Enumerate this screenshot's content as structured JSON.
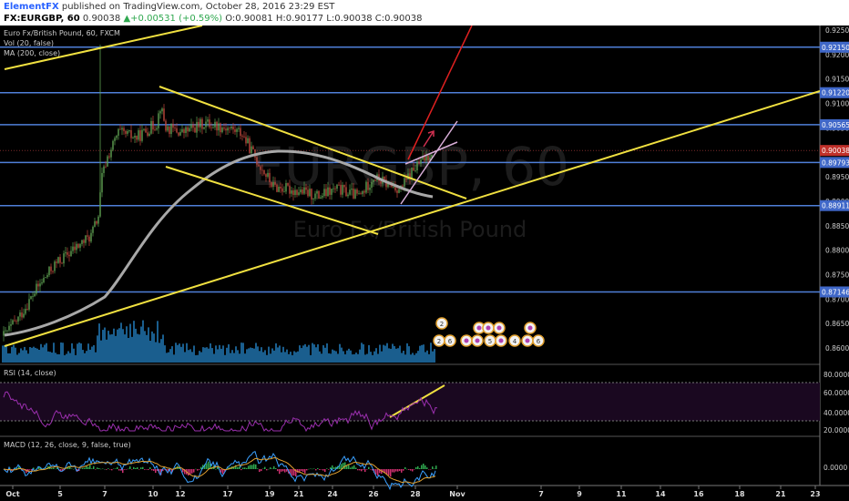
{
  "header": {
    "author": "ElementFX",
    "published": "published on TradingView.com, October 28, 2016 23:29 EST",
    "symbol": "FX:EURGBP, 60",
    "last": "0.90038",
    "change_arrow": "▲",
    "change": "+0.00531 (+0.59%)",
    "o_label": "O:",
    "o": "0.90081",
    "h_label": "H:",
    "h": "0.90177",
    "l_label": "L:",
    "l": "0.90038",
    "c_label": "C:",
    "c": "0.90038"
  },
  "pane_labels": {
    "title": "Euro Fx/British Pound, 60, FXCM",
    "vol": "Vol (20, false)",
    "ma": "MA (200, close)",
    "rsi": "RSI (14, close)",
    "macd": "MACD (12, 26, close, 9, false, true)"
  },
  "watermark": {
    "symbol": "EURGBP, 60",
    "name": "Euro Fx/British Pound"
  },
  "price_axis": [
    "0.92500",
    "0.92000",
    "0.91500",
    "0.91000",
    "0.90500",
    "0.90000",
    "0.89500",
    "0.89000",
    "0.88500",
    "0.88000",
    "0.87500",
    "0.87000",
    "0.86500",
    "0.86000"
  ],
  "price_levels": [
    {
      "label": "0.92150",
      "value": 0.9215,
      "type": "support"
    },
    {
      "label": "0.91220",
      "value": 0.9122,
      "type": "support"
    },
    {
      "label": "0.90565",
      "value": 0.90565,
      "type": "support"
    },
    {
      "label": "0.90038",
      "value": 0.90038,
      "type": "last"
    },
    {
      "label": "0.89793",
      "value": 0.89793,
      "type": "support"
    },
    {
      "label": "0.88911",
      "value": 0.88911,
      "type": "support"
    },
    {
      "label": "0.87146",
      "value": 0.87146,
      "type": "support"
    }
  ],
  "rsi_axis": [
    "80.0000",
    "60.0000",
    "40.0000",
    "20.0000"
  ],
  "macd_axis": [
    "0.0000"
  ],
  "time_axis": [
    "Oct",
    "5",
    "7",
    "10",
    "12",
    "17",
    "19",
    "21",
    "24",
    "26",
    "28",
    "Nov",
    "7",
    "9",
    "11",
    "14",
    "16",
    "18",
    "21",
    "23"
  ],
  "colors": {
    "level": "#4f7fd8",
    "label_bg": "#3f67c8",
    "trend": "#f0e040",
    "ma": "#a8a8a8",
    "candle_up": "#5ea152",
    "candle_down": "#c0483d",
    "volume": "#1e6ea7",
    "rsi": "#9b2fae",
    "projection_red": "#e02020",
    "projection_pink": "#d8aed8",
    "last_bg": "#c0302a"
  }
}
